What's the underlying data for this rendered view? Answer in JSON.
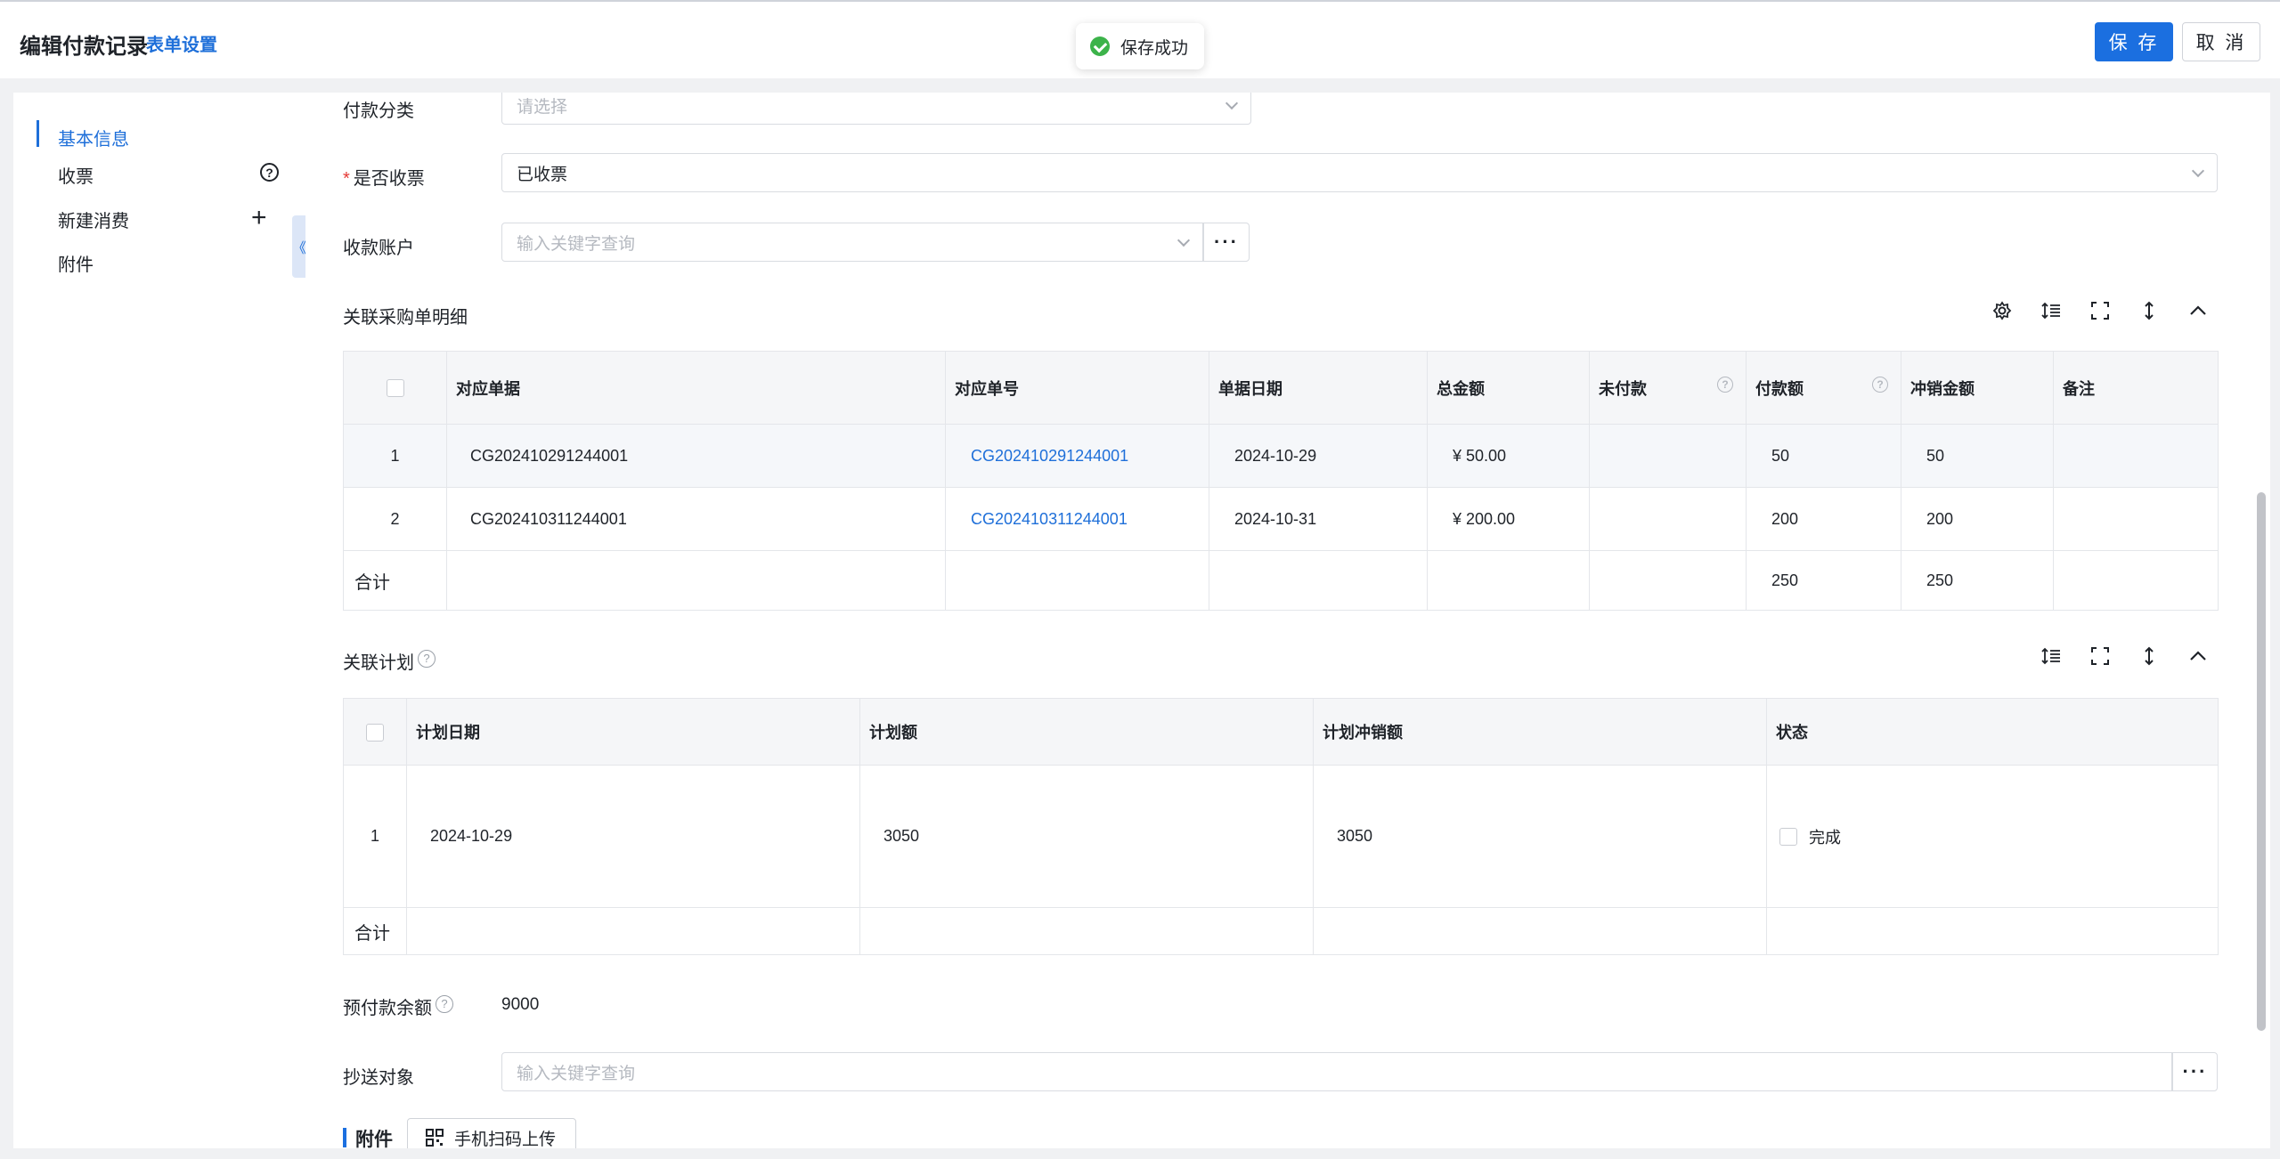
{
  "header": {
    "title": "编辑付款记录",
    "form_settings": "表单设置",
    "toast": "保存成功",
    "save": "保 存",
    "cancel": "取 消"
  },
  "sidebar": {
    "items": [
      {
        "label": "基本信息",
        "active": true
      },
      {
        "label": "收票"
      },
      {
        "label": "新建消费"
      },
      {
        "label": "附件"
      }
    ],
    "collapse_glyph": "《"
  },
  "form": {
    "payment_category": {
      "label": "付款分类",
      "placeholder": "请选择"
    },
    "invoice_received": {
      "required_mark": "*",
      "label": "是否收票",
      "value": "已收票"
    },
    "receiving_account": {
      "label": "收款账户",
      "placeholder": "输入关键字查询",
      "more": "···"
    }
  },
  "purchase_section": {
    "title": "关联采购单明细",
    "columns": [
      "对应单据",
      "对应单号",
      "单据日期",
      "总金额",
      "未付款",
      "付款额",
      "冲销金额",
      "备注"
    ],
    "rows": [
      {
        "index": "1",
        "doc": "CG202410291244001",
        "doc_no": "CG202410291244001",
        "date": "2024-10-29",
        "total": "¥ 50.00",
        "unpaid": "",
        "paid": "50",
        "writeoff": "50",
        "note": ""
      },
      {
        "index": "2",
        "doc": "CG202410311244001",
        "doc_no": "CG202410311244001",
        "date": "2024-10-31",
        "total": "¥ 200.00",
        "unpaid": "",
        "paid": "200",
        "writeoff": "200",
        "note": ""
      }
    ],
    "total_row": {
      "label": "合计",
      "paid": "250",
      "writeoff": "250"
    }
  },
  "plan_section": {
    "title": "关联计划",
    "columns": [
      "计划日期",
      "计划额",
      "计划冲销额",
      "状态"
    ],
    "rows": [
      {
        "index": "1",
        "date": "2024-10-29",
        "amount": "3050",
        "writeoff": "3050",
        "status": "完成"
      }
    ],
    "total_row": {
      "label": "合计"
    }
  },
  "prepay": {
    "label": "预付款余额",
    "value": "9000"
  },
  "cc": {
    "label": "抄送对象",
    "placeholder": "输入关键字查询",
    "more": "···"
  },
  "attachment": {
    "title": "附件",
    "scan_button": "手机扫码上传"
  },
  "colors": {
    "accent": "#1b6fe0",
    "link": "#1e6fd9",
    "success": "#3cb34a",
    "required": "#e53935"
  }
}
